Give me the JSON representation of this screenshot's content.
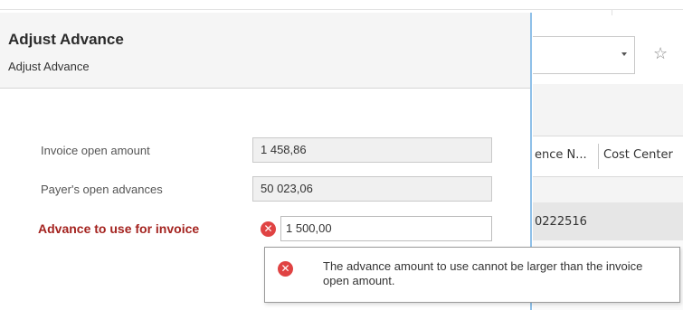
{
  "dialog": {
    "title": "Adjust Advance",
    "subtitle": "Adjust Advance",
    "fields": {
      "invoice_open_amount": {
        "label": "Invoice open amount",
        "value": "1 458,86"
      },
      "payers_open_advances": {
        "label": "Payer's open advances",
        "value": "50 023,06"
      },
      "advance_to_use": {
        "label": "Advance to use for invoice",
        "value": "1 500,00"
      }
    },
    "error_tooltip": {
      "message": "The advance amount to use cannot be larger than the invoice open amount."
    }
  },
  "background": {
    "grid_headers": [
      "ence N...",
      "Cost Center"
    ],
    "grid_row_value": "0222516"
  },
  "icons": {
    "error": "error-circle-icon",
    "favorite": "star-icon",
    "dropdown": "chevron-down-icon"
  },
  "colors": {
    "error_label": "#a4231f",
    "error_icon": "#e04343",
    "dialog_border": "#8fc0e8"
  }
}
